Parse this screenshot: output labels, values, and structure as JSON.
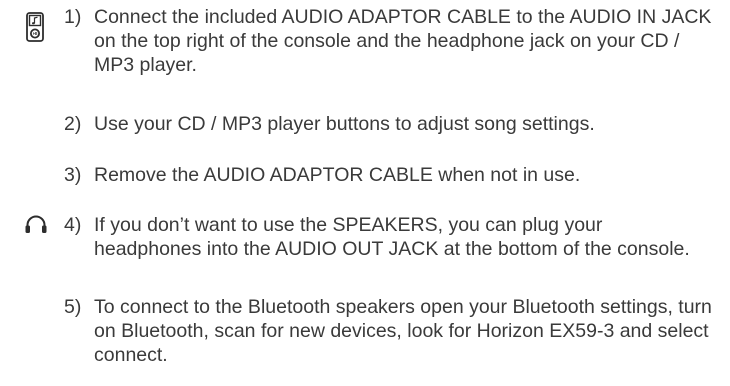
{
  "steps": [
    {
      "number": "1)",
      "text": "Connect the included AUDIO ADAPTOR CABLE to the AUDIO IN JACK on the top right of the console and the headphone jack on your CD / MP3 player.",
      "icon": "mp3-player-icon"
    },
    {
      "number": "2)",
      "text": "Use your CD / MP3 player buttons to adjust song settings."
    },
    {
      "number": "3)",
      "text": "Remove the AUDIO ADAPTOR CABLE when not in use."
    },
    {
      "number": "4)",
      "text": "If you don’t want to use the SPEAKERS, you can plug your headphones into the AUDIO OUT JACK at the bottom of the console.",
      "icon": "headphones-icon"
    },
    {
      "number": "5)",
      "text": "To connect to the Bluetooth speakers open your Bluetooth settings, turn on Bluetooth, scan for new devices, look for Horizon EX59-3 and select connect."
    }
  ]
}
